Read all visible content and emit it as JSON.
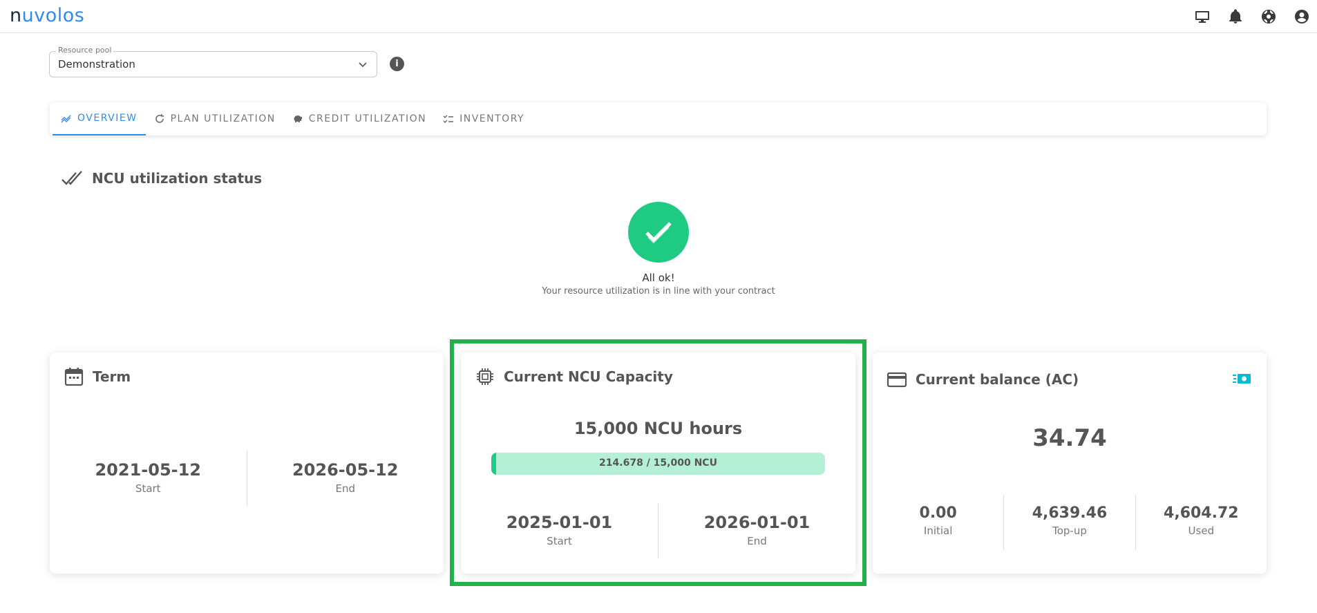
{
  "app": {
    "logo_n": "n",
    "logo_rest": "uvolos"
  },
  "topbar": {
    "icons": [
      "monitor-icon",
      "bell-icon",
      "lifebuoy-icon",
      "account-icon"
    ]
  },
  "resource_pool": {
    "label": "Resource pool",
    "value": "Demonstration"
  },
  "tabs": [
    {
      "label": "OVERVIEW",
      "icon": "chart-line-icon",
      "active": true
    },
    {
      "label": "PLAN UTILIZATION",
      "icon": "refresh-icon",
      "active": false
    },
    {
      "label": "CREDIT UTILIZATION",
      "icon": "piggy-bank-icon",
      "active": false
    },
    {
      "label": "INVENTORY",
      "icon": "checklist-icon",
      "active": false
    }
  ],
  "status": {
    "title": "NCU utilization status",
    "ok_title": "All ok!",
    "ok_subtitle": "Your resource utilization is in line with your contract"
  },
  "term": {
    "title": "Term",
    "start_date": "2021-05-12",
    "start_label": "Start",
    "end_date": "2026-05-12",
    "end_label": "End"
  },
  "capacity": {
    "title": "Current NCU Capacity",
    "main": "15,000 NCU hours",
    "bar_text": "214.678 / 15,000 NCU",
    "used_fraction": 0.0143,
    "start_date": "2025-01-01",
    "start_label": "Start",
    "end_date": "2026-01-01",
    "end_label": "End"
  },
  "balance": {
    "title": "Current balance (AC)",
    "value": "34.74",
    "initial": "0.00",
    "initial_label": "Initial",
    "topup": "4,639.46",
    "topup_label": "Top-up",
    "used": "4,604.72",
    "used_label": "Used"
  },
  "colors": {
    "accent": "#2d8cf0",
    "ok_green": "#1fcb82",
    "highlight": "#22b14c",
    "cash": "#00bcd4"
  }
}
